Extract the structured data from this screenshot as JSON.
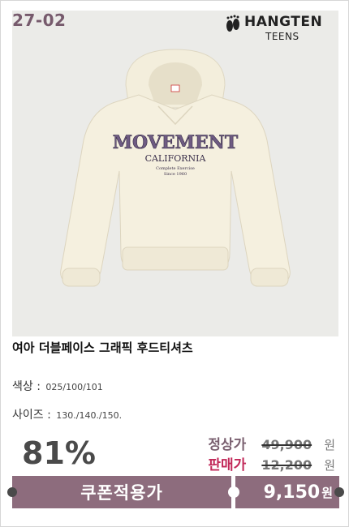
{
  "card": {
    "product_code": "27-02",
    "brand_name": "HANGTEN",
    "brand_sub": "TEENS",
    "print_main": "MOVEMENT",
    "print_sub": "CALIFORNIA",
    "print_line1": "Complete Exercise",
    "print_line2": "Since 1960",
    "title": "여아 더블페이스 그래픽 후드티셔츠",
    "color_label": "색상 :",
    "color_value": "025/100/101",
    "size_label": "사이즈 :",
    "size_value": "130./140./150.",
    "discount": "81%",
    "regular_label": "정상가",
    "regular_price": "49,900",
    "sale_label": "판매가",
    "sale_price": "12,200",
    "currency": "원",
    "coupon_label": "쿠폰적용가",
    "coupon_price": "9,150",
    "coupon_currency": "원"
  },
  "colors": {
    "accent": "#8d6c7d",
    "sale_red": "#c22a5a",
    "code_color": "#765a6c",
    "photo_bg": "#ebebe8",
    "hoodie": "#f5f0df"
  }
}
